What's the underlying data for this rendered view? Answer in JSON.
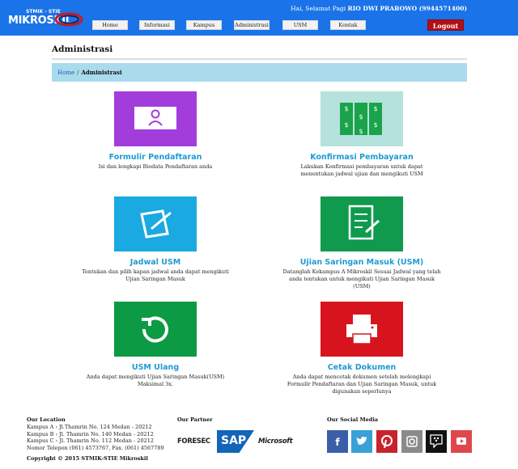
{
  "header": {
    "logo_top": "STMIK - STIE",
    "logo_main": "MIKROSKIL",
    "greeting_prefix": "Hai, Selamat Pagi",
    "user_name": "RIO DWI PRABOWO (9944571400)",
    "nav": [
      "Home",
      "Informasi",
      "Kampus",
      "Administrasi",
      "USM",
      "Kontak"
    ],
    "logout_label": "Logout"
  },
  "page": {
    "title": "Administrasi",
    "breadcrumb": {
      "home": "Home",
      "separator": "/",
      "current": "Administrasi"
    }
  },
  "cards": [
    {
      "title": "Formulir Pendaftaran",
      "desc": "Isi dan lengkapi Biodata Pendaftaran anda",
      "color": "#a23ddc",
      "icon": "user-form-icon"
    },
    {
      "title": "Konfirmasi Pembayaran",
      "desc": "Lakukan Konfirmasi pembayaran untuk dapat menentukan jadwal ujian dan mengikuti USM",
      "color": "#b5e2dc",
      "icon": "money-stack-icon"
    },
    {
      "title": "Jadwal USM",
      "desc": "Tentukan dan pilih kapan jadwal anda dapat mengikuti Ujian Saringan Masuk",
      "color": "#1aa9e0",
      "icon": "edit-note-icon"
    },
    {
      "title": "Ujian Saringan Masuk (USM)",
      "desc": "Datanglah Kekampus A Mikroskil Sesuai Jadwal yang telah anda tentukan untuk mengikuti Ujian Saringan Masuk (USM)",
      "color": "#0f9a4d",
      "icon": "notebook-pen-icon"
    },
    {
      "title": "USM Ulang",
      "desc": "Anda dapat mengikuti Ujian Saringan Masuk(USM) Maksimal 3x.",
      "color": "#0c9a44",
      "icon": "refresh-icon"
    },
    {
      "title": "Cetak Dokumen",
      "desc": "Anda dapat mencetak dokumen setelah melengkapi Formulir Pendaftaran dan Ujian Saringan Masuk, untuk digunakan seperlunya",
      "color": "#d7141d",
      "icon": "printer-icon"
    }
  ],
  "footer": {
    "location": {
      "heading": "Our Location",
      "lines": [
        "Kampus A › Jl.Thamrin No. 124 Medan - 20212",
        "Kampus B › Jl. Thamrin No. 140 Medan - 20212",
        "Kampus C › Jl. Thamrin No. 112 Medan - 20212",
        "Nomor Telepon (061) 4573767, Fax. (061) 4567789"
      ]
    },
    "partner": {
      "heading": "Our Partner",
      "logos": [
        "FORESEC",
        "SAP",
        "Microsoft"
      ]
    },
    "social": {
      "heading": "Our Social Media",
      "items": [
        {
          "name": "facebook",
          "color": "#3b5ea8",
          "glyph": "f"
        },
        {
          "name": "twitter",
          "color": "#38a1d6",
          "glyph": "t"
        },
        {
          "name": "pinterest",
          "color": "#c8232c",
          "glyph": "p"
        },
        {
          "name": "instagram",
          "color": "#8a8a8a",
          "glyph": "i"
        },
        {
          "name": "bbm",
          "color": "#111111",
          "glyph": "b"
        },
        {
          "name": "youtube",
          "color": "#e0474c",
          "glyph": "y"
        }
      ]
    },
    "copyright": "Copyright © 2015 STMIK-STIE Mikroskil"
  }
}
